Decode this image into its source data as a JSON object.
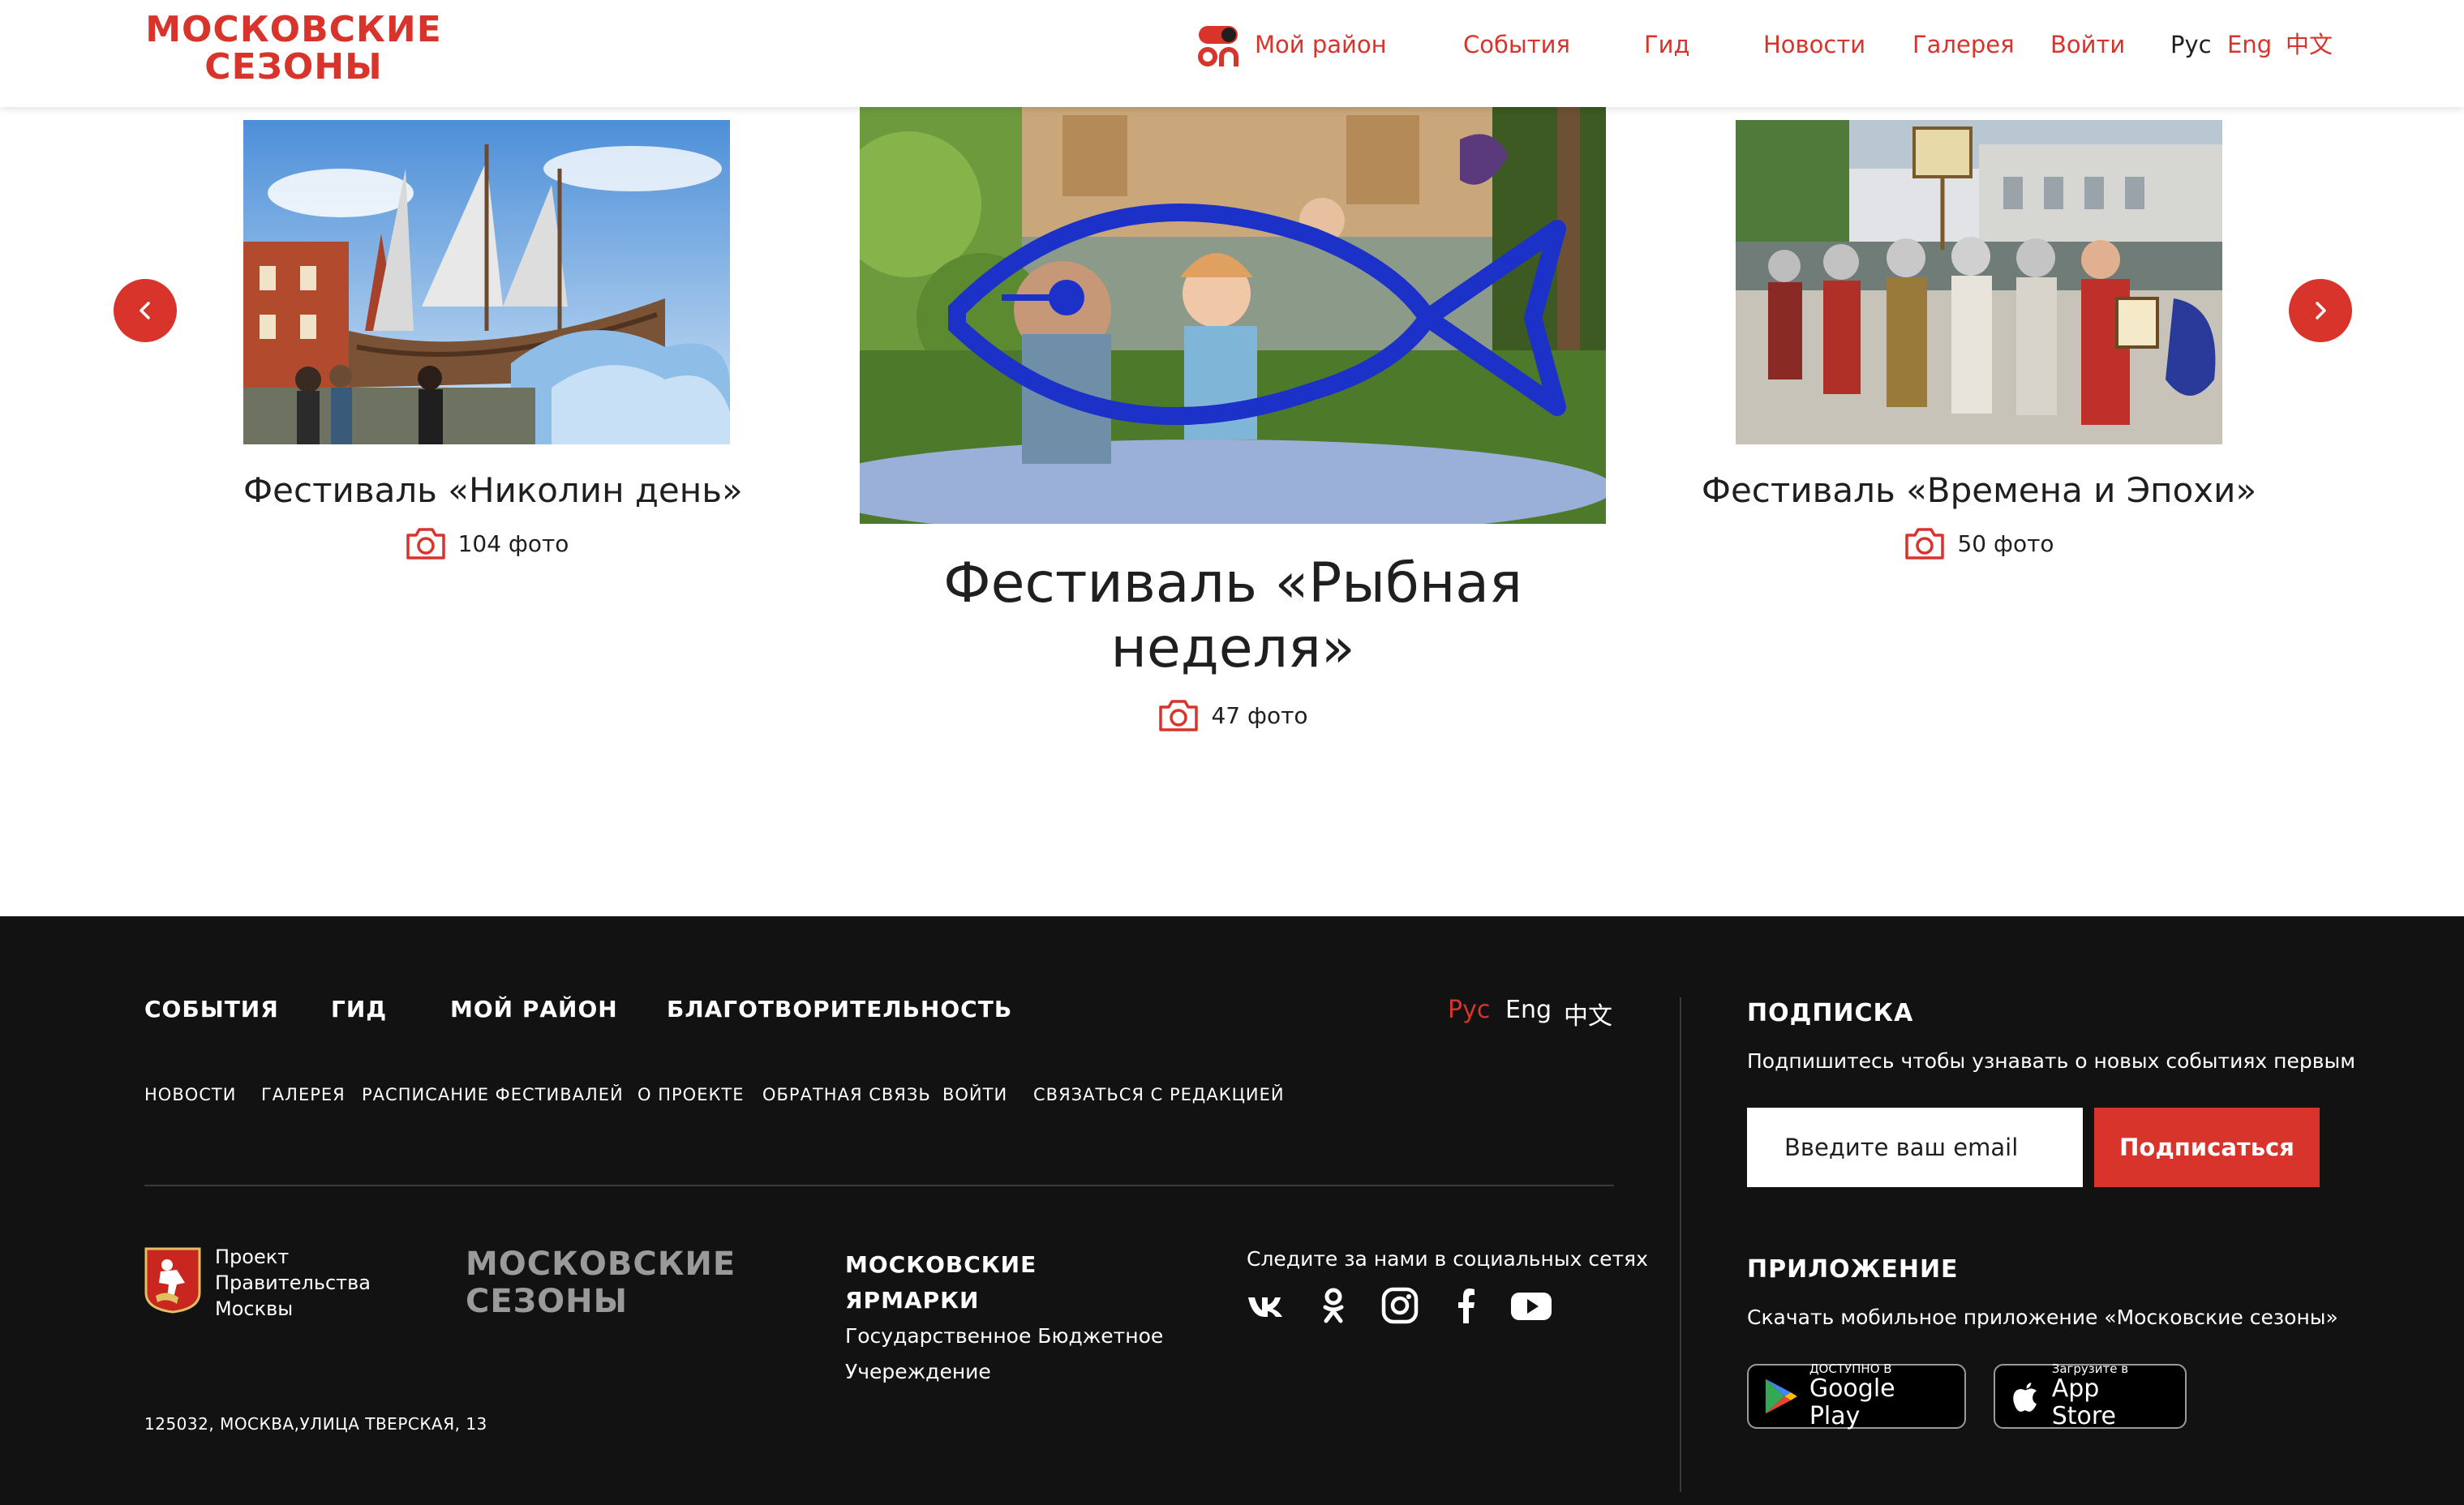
{
  "header": {
    "logo_line1": "МОСКОВСКИЕ",
    "logo_line2": "СЕЗОНЫ",
    "nav": {
      "my_rayon": "Мой район",
      "events": "События",
      "guide": "Гид",
      "news": "Новости",
      "gallery": "Галерея",
      "login": "Войти"
    },
    "lang": {
      "ru": "Рус",
      "en": "Eng",
      "zh": "中文"
    }
  },
  "carousel": {
    "cards": [
      {
        "title": "Фестиваль «Николин день»",
        "count": "104 фото"
      },
      {
        "title_line1": "Фестиваль «Рыбная",
        "title_line2": "неделя»",
        "count": "47 фото"
      },
      {
        "title": "Фестиваль «Времена и Эпохи»",
        "count": "50 фото"
      }
    ]
  },
  "footer": {
    "main_links": {
      "events": "СОБЫТИЯ",
      "guide": "ГИД",
      "my_rayon": "МОЙ РАЙОН",
      "charity": "БЛАГОТВОРИТЕЛЬНОСТЬ"
    },
    "lang": {
      "ru": "Рус",
      "en": "Eng",
      "zh": "中文"
    },
    "sub_links": {
      "news": "НОВОСТИ",
      "gallery": "ГАЛЕРЕЯ",
      "schedule": "РАСПИСАНИЕ ФЕСТИВАЛЕЙ",
      "about": "О ПРОЕКТЕ",
      "feedback": "ОБРАТНАЯ СВЯЗЬ",
      "login": "ВОЙТИ",
      "contact": "СВЯЗАТЬСЯ С РЕДАКЦИЕЙ"
    },
    "gov": {
      "line1": "Проект",
      "line2": "Правительства",
      "line3": "Москвы"
    },
    "logo_line1": "МОСКОВСКИЕ",
    "logo_line2": "СЕЗОНЫ",
    "fairs": {
      "title_line1": "МОСКОВСКИЕ",
      "title_line2": "ЯРМАРКИ",
      "desc_line1": "Государственное Бюджетное",
      "desc_line2": "Учереждение"
    },
    "social_title": "Следите за нами в социальных сетях",
    "address": "125032, МОСКВА,УЛИЦА ТВЕРСКАЯ, 13",
    "subscribe": {
      "title": "ПОДПИСКА",
      "text": "Подпишитесь чтобы узнавать о новых событиях первым",
      "placeholder": "Введите ваш email",
      "button": "Подписаться"
    },
    "app": {
      "title": "ПРИЛОЖЕНИЕ",
      "text": "Скачать мобильное приложение «Московские сезоны»",
      "google_small": "ДОСТУПНО В",
      "google_big": "Google Play",
      "apple_small": "Загрузите в",
      "apple_big": "App Store"
    }
  },
  "colors": {
    "accent": "#d8342b",
    "footer_bg": "#121212",
    "text": "#1f1f1f"
  }
}
